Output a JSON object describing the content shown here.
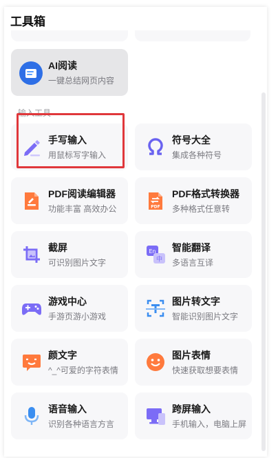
{
  "header": {
    "title": "工具箱"
  },
  "ai_card": {
    "name": "AI阅读",
    "desc": "一键总结网页内容"
  },
  "section": {
    "label": "输入工具"
  },
  "tools": [
    {
      "name": "手写输入",
      "desc": "用鼠标写字输入",
      "icon": "pen-icon"
    },
    {
      "name": "符号大全",
      "desc": "集成各种符号",
      "icon": "omega-icon"
    },
    {
      "name": "PDF阅读编辑器",
      "desc": "功能丰富 高效办公",
      "icon": "pdf-edit-icon"
    },
    {
      "name": "PDF格式转换器",
      "desc": "多种格式任意转",
      "icon": "pdf-convert-icon"
    },
    {
      "name": "截屏",
      "desc": "可识别图片文字",
      "icon": "screenshot-icon"
    },
    {
      "name": "智能翻译",
      "desc": "多语言互译",
      "icon": "translate-icon"
    },
    {
      "name": "游戏中心",
      "desc": "手游页游小游戏",
      "icon": "gamepad-icon"
    },
    {
      "name": "图片转文字",
      "desc": "智能识别图片文字",
      "icon": "image-to-text-icon"
    },
    {
      "name": "颜文字",
      "desc": "^_^可爱的字符表情",
      "icon": "kaomoji-icon"
    },
    {
      "name": "图片表情",
      "desc": "快速获取想要表情",
      "icon": "smiley-icon"
    },
    {
      "name": "语音输入",
      "desc": "识别各种语言方言",
      "icon": "microphone-icon"
    },
    {
      "name": "跨屏输入",
      "desc": "手机输入，电脑上屏",
      "icon": "cross-screen-icon"
    }
  ],
  "colors": {
    "highlight": "#e0373b",
    "purple": "#7b6cf6",
    "orange": "#ff7a3d",
    "blue": "#3b8ef0"
  }
}
